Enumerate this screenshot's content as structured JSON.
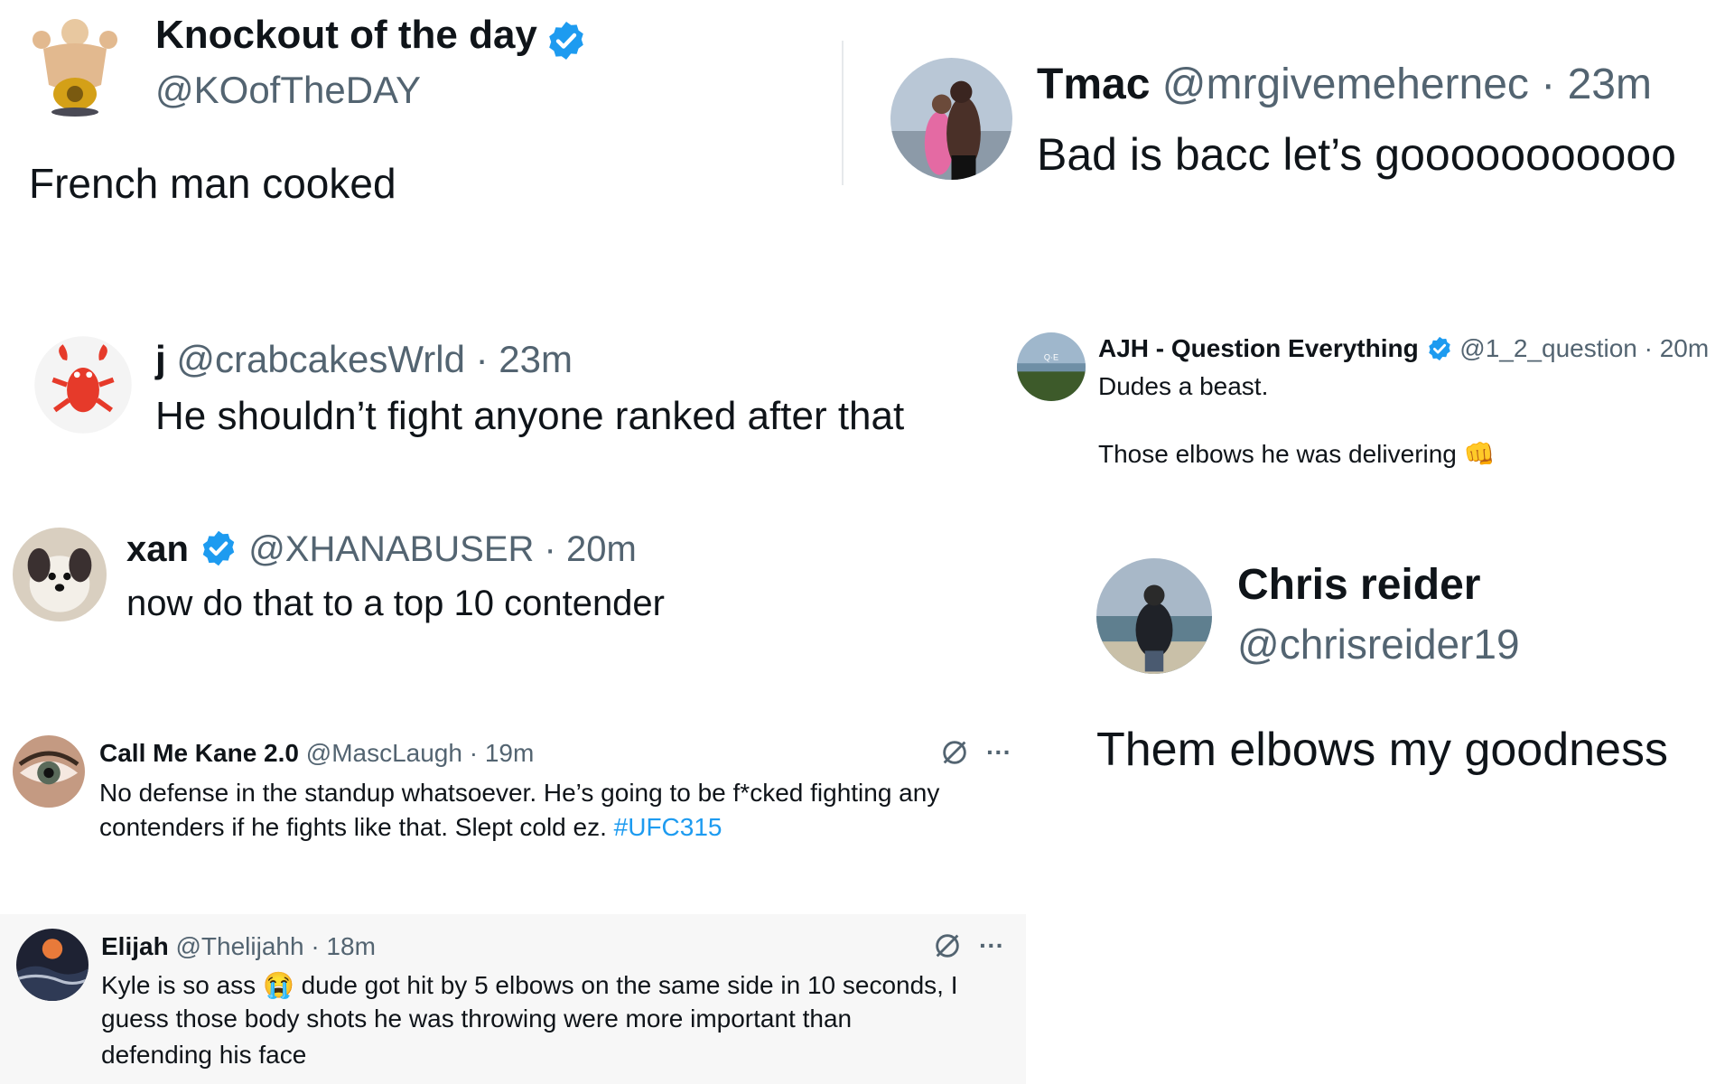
{
  "colors": {
    "verified": "#1d9bf0",
    "text": "#0f1419",
    "muted": "#536471",
    "link": "#1d9bf0"
  },
  "tweets": [
    {
      "name": "Knockout of the day",
      "handle": "@KOofTheDAY",
      "time": "",
      "text": "French man cooked",
      "verified": true,
      "avatar_icon": "muscle-man-belt-avatar"
    },
    {
      "name": "Tmac",
      "handle": "@mrgivemehernec · 23m",
      "text": "Bad is bacc let’s gooooooooooo",
      "verified": false,
      "avatar_icon": "couple-photo-avatar"
    },
    {
      "name": "j",
      "handle": "@crabcakesWrld · 23m",
      "text": "He shouldn’t fight anyone ranked after that",
      "verified": false,
      "avatar_icon": "crab-avatar"
    },
    {
      "name": "AJH - Question Everything",
      "handle": "@1_2_question · 20m",
      "text_line1": "Dudes a beast.",
      "text_line2": "Those elbows he was delivering",
      "emoji": "👊",
      "verified": true,
      "avatar_icon": "landscape-avatar"
    },
    {
      "name": "xan",
      "handle": "@XHANABUSER · 20m",
      "text": "now do that to a top 10 contender",
      "verified": true,
      "avatar_icon": "dog-avatar"
    },
    {
      "name": "Chris reider",
      "handle": "@chrisreider19",
      "text": "Them elbows my goodness",
      "verified": false,
      "avatar_icon": "man-beach-avatar"
    },
    {
      "name": "Call Me Kane 2.0",
      "handle": "@MascLaugh · 19m",
      "text_line1": "No defense in the standup whatsoever. He’s going to be f*cked fighting any",
      "text_line2": "contenders if he fights like that. Slept cold ez.",
      "hashtag": "#UFC315",
      "verified": false,
      "avatar_icon": "eye-avatar"
    },
    {
      "name": "Elijah",
      "handle": "@Thelijahh · 18m",
      "text_line1a": "Kyle is so ass",
      "emoji": "😭",
      "text_line1b": "dude got hit by 5 elbows on the same side in 10 seconds, I",
      "text_line2": "guess those body shots he was throwing were more important than",
      "text_line3": "defending his face",
      "verified": false,
      "avatar_icon": "sunset-avatar"
    }
  ],
  "more_label": "···"
}
